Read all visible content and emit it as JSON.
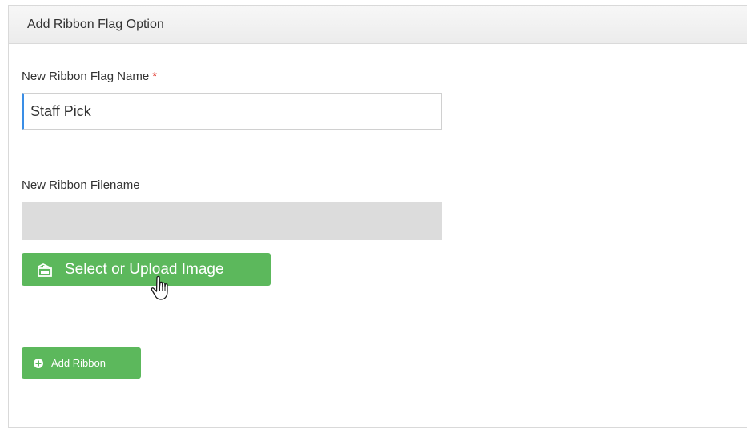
{
  "panel": {
    "title": "Add Ribbon Flag Option"
  },
  "name_field": {
    "label": "New Ribbon Flag Name",
    "required_marker": "*",
    "value": "Staff Pick"
  },
  "filename_field": {
    "label": "New Ribbon Filename",
    "value": ""
  },
  "upload_button": {
    "label": "Select or Upload Image",
    "icon": "image-folder-icon"
  },
  "add_button": {
    "label": "Add Ribbon",
    "icon": "plus-circle-icon"
  },
  "colors": {
    "button_green": "#5cb85c",
    "required_red": "#e0392f",
    "focus_blue": "#3a8ee6",
    "disabled_gray": "#dcdcdc"
  }
}
